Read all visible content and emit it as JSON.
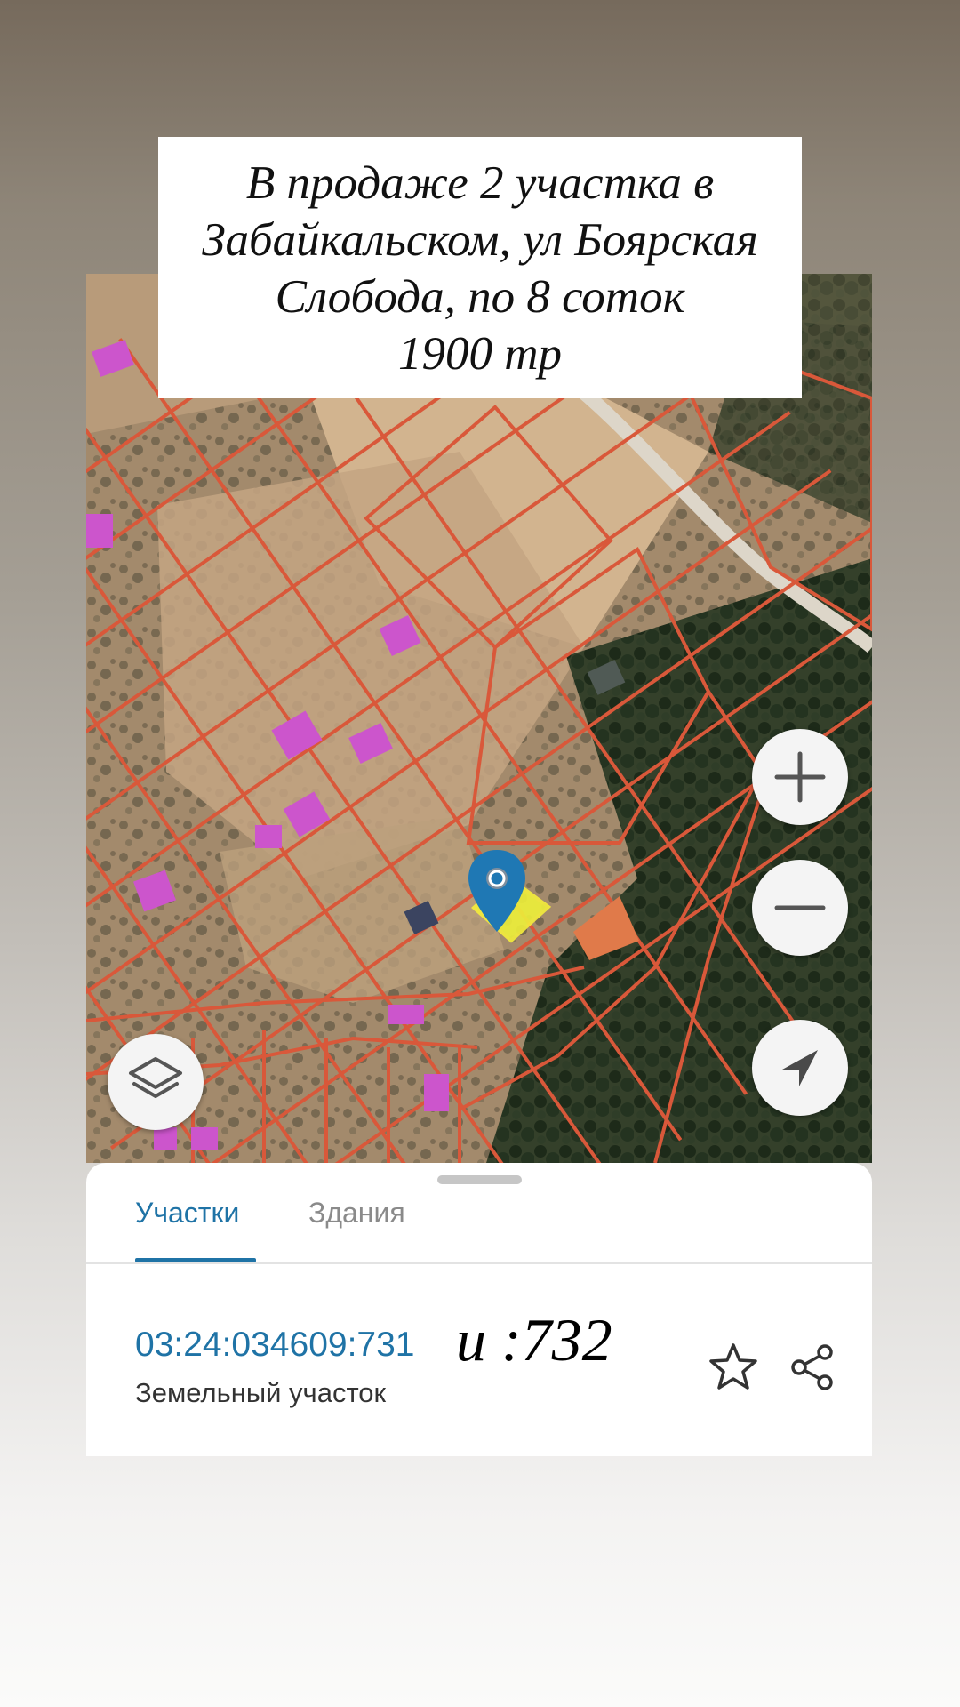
{
  "caption": {
    "lines": [
      "В продаже 2 участка в",
      "Забайкальском, ул Боярская",
      "Слобода, по 8 соток",
      "1900 тр"
    ]
  },
  "map": {
    "controls": {
      "zoom_in_icon": "plus-icon",
      "zoom_out_icon": "minus-icon",
      "locate_icon": "navigation-arrow-icon",
      "layers_icon": "layers-icon"
    },
    "colors": {
      "parcel_border": "#d9583a",
      "building": "#cc55cc",
      "selected_parcel": "#eef03a",
      "pin": "#1f78b4"
    }
  },
  "sheet": {
    "tabs": [
      {
        "label": "Участки",
        "active": true
      },
      {
        "label": "Здания",
        "active": false
      }
    ],
    "parcel": {
      "cadastral_number": "03:24:034609:731",
      "overlay_text": "и :732",
      "type": "Земельный участок"
    },
    "icons": {
      "favorite": "star-icon",
      "share": "share-icon"
    }
  }
}
